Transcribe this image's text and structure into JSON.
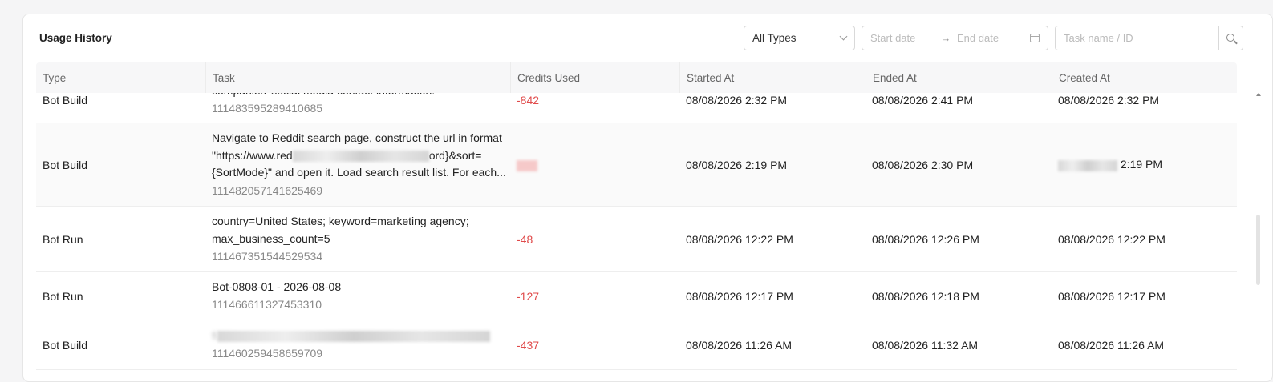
{
  "card": {
    "title": "Usage History"
  },
  "filters": {
    "type_select": "All Types",
    "start_placeholder": "Start date",
    "range_arrow": "→",
    "end_placeholder": "End date",
    "search_placeholder": "Task name / ID"
  },
  "table": {
    "headers": [
      "Type",
      "Task",
      "Credits Used",
      "Started At",
      "Ended At",
      "Created At"
    ],
    "rows": [
      {
        "type": "Bot Build",
        "task_lines": [
          "companies' social media contact information."
        ],
        "task_id": "111483595289410685",
        "credits": "-842",
        "started": "08/08/2026 2:32 PM",
        "ended": "08/08/2026 2:41 PM",
        "created": "08/08/2026 2:32 PM"
      },
      {
        "type": "Bot Build",
        "task_lines": [
          "Navigate to Reddit search page, construct the url in format",
          "\"https://www.red",
          "ord}&sort=",
          "{SortMode}\" and open it. Load search result list. For each..."
        ],
        "task_id": "111482057141625469",
        "credits": "",
        "started": "08/08/2026 2:19 PM",
        "ended_a": "08/08/",
        "ended_b": "2026 2:30 PM",
        "created_b": "2:19 PM"
      },
      {
        "type": "Bot Run",
        "task_lines": [
          "country=United States; keyword=marketing agency;",
          "max_business_count=5"
        ],
        "task_id": "111467351544529534",
        "credits": "-48",
        "started": "08/08/2026 12:22 PM",
        "ended": "08/08/2026 12:26 PM",
        "created": "08/08/2026 12:22 PM"
      },
      {
        "type": "Bot Run",
        "task_lines": [
          "Bot-0808-01 - 2026-08-08"
        ],
        "task_id": "111466611327453310",
        "credits": "-127",
        "started": "08/08/2026 12:17 PM",
        "ended": "08/08/2026 12:18 PM",
        "created": "08/08/2026 12:17 PM"
      },
      {
        "type": "Bot Build",
        "task_lines": [
          "fi"
        ],
        "task_id": "111460259458659709",
        "credits": "-437",
        "started": "08/08/2026 11:26 AM",
        "ended": "08/08/2026 11:32 AM",
        "created": "08/08/2026 11:26 AM"
      }
    ]
  },
  "colors": {
    "negative": "#e04b4b",
    "header_bg": "#f7f7f8"
  },
  "icons": [
    "chevron-down-icon",
    "calendar-icon",
    "search-icon",
    "scroll-up-icon"
  ]
}
